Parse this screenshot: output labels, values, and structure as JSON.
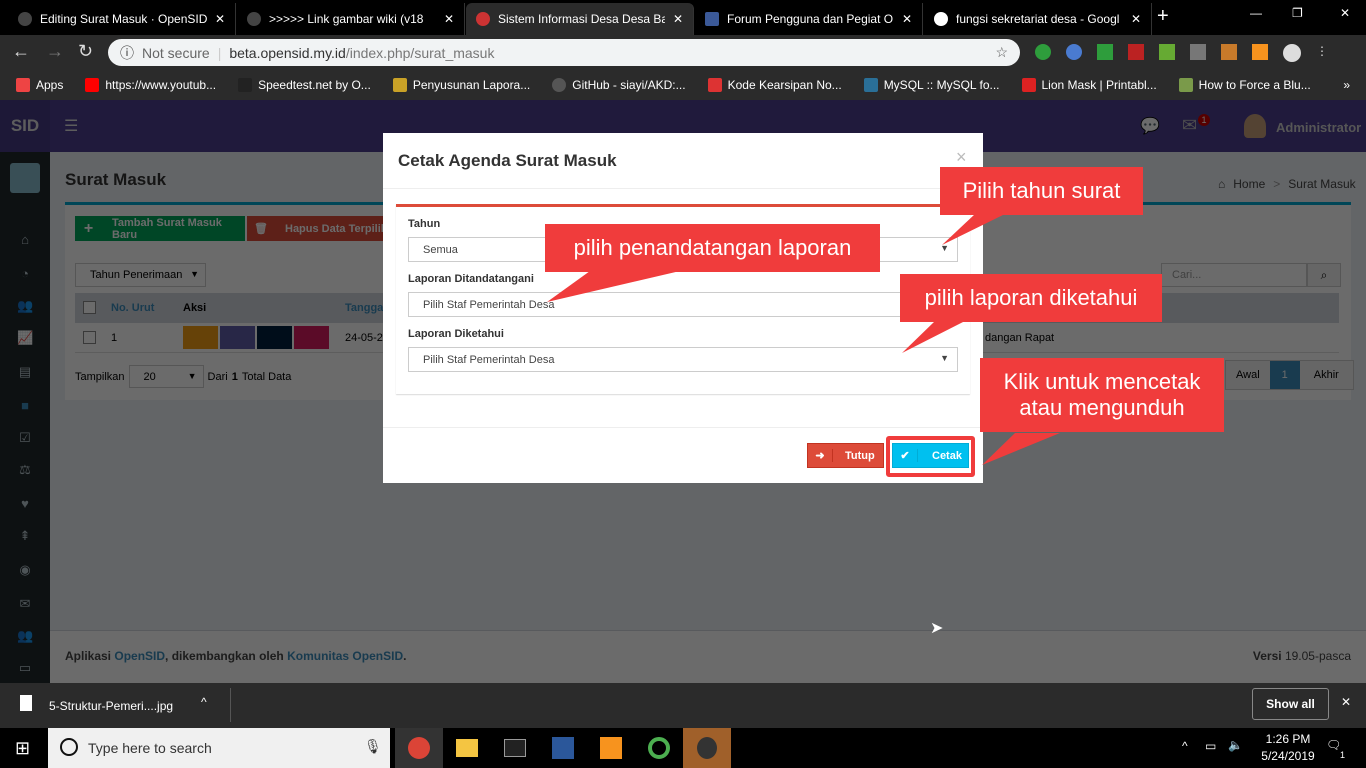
{
  "browser": {
    "tabs": [
      {
        "label": "Editing Surat Masuk · OpenSID"
      },
      {
        "label": ">>>>> Link gambar wiki (v18"
      },
      {
        "label": "Sistem Informasi Desa Desa Ba",
        "active": true
      },
      {
        "label": "Forum Pengguna dan Pegiat O"
      },
      {
        "label": "fungsi sekretariat desa - Googl"
      }
    ],
    "security": "Not secure",
    "url_host": "beta.opensid.my.id",
    "url_path": "/index.php/surat_masuk",
    "bookmarks": [
      "Apps",
      "https://www.youtub...",
      "Speedtest.net by O...",
      "Penyusunan Lapora...",
      "GitHub - siayi/AKD:...",
      "Kode Kearsipan No...",
      "MySQL :: MySQL fo...",
      "Lion Mask | Printabl...",
      "How to Force a Blu..."
    ]
  },
  "app": {
    "logo": "SID",
    "notif_count": "1",
    "user": "Administrator",
    "page_title": "Surat Masuk",
    "breadcrumb": [
      "Home",
      "Surat Masuk"
    ],
    "add_button": "Tambah Surat Masuk Baru",
    "delete_button": "Hapus Data Terpilih",
    "year_filter": "Tahun Penerimaan",
    "search_placeholder": "Cari...",
    "columns": [
      "No. Urut",
      "Aksi",
      "Tanggal"
    ],
    "row": {
      "no": "1",
      "date": "24-05-20",
      "tail": "dangan Rapat"
    },
    "show_label": "Tampilkan",
    "per_page": "20",
    "total_pre": "Dari",
    "total": "1",
    "total_post": "Total Data",
    "pager": [
      "Awal",
      "1",
      "Akhir"
    ],
    "footer": {
      "pre": "Aplikasi",
      "link1": "OpenSID",
      "mid": ", dikembangkan oleh",
      "link2": "Komunitas OpenSID",
      "end": ".",
      "version_label": "Versi",
      "version": "19.05-pasca"
    }
  },
  "modal": {
    "title": "Cetak Agenda Surat Masuk",
    "close": "×",
    "fields": [
      {
        "label": "Tahun",
        "value": "Semua"
      },
      {
        "label": "Laporan Ditandatangani",
        "value": "Pilih Staf Pemerintah Desa"
      },
      {
        "label": "Laporan Diketahui",
        "value": "Pilih Staf Pemerintah Desa"
      }
    ],
    "close_button": "Tutup",
    "print_button": "Cetak"
  },
  "callouts": [
    "Pilih tahun surat",
    "pilih penandatangan laporan",
    "pilih laporan diketahui",
    "Klik untuk mencetak atau mengunduh"
  ],
  "colors": {
    "callout": "#f03c3c",
    "header": "#4b3f8f",
    "primary": "#00c0ef",
    "danger": "#dd4b39"
  },
  "download": {
    "file": "5-Struktur-Pemeri....jpg",
    "show_all": "Show all"
  },
  "taskbar": {
    "search": "Type here to search",
    "time": "1:26 PM",
    "date": "5/24/2019",
    "notifications": "1"
  }
}
